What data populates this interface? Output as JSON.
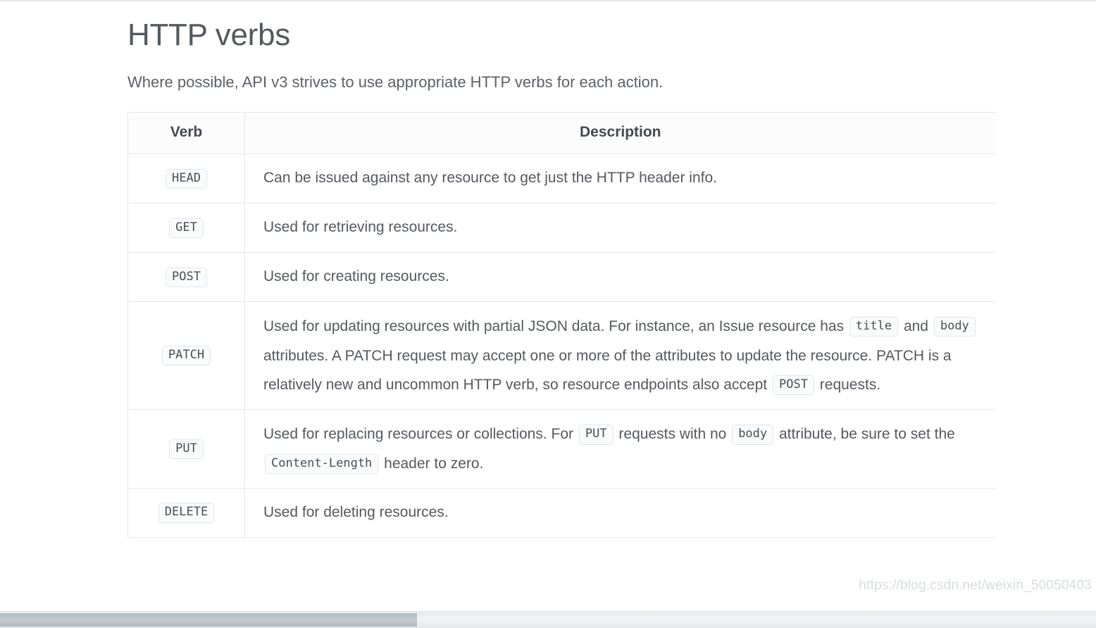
{
  "page": {
    "title": "HTTP verbs",
    "intro": "Where possible, API v3 strives to use appropriate HTTP verbs for each action."
  },
  "table": {
    "headers": {
      "verb": "Verb",
      "description": "Description"
    },
    "rows": [
      {
        "verb": "HEAD",
        "description": "Can be issued against any resource to get just the HTTP header info."
      },
      {
        "verb": "GET",
        "description": "Used for retrieving resources."
      },
      {
        "verb": "POST",
        "description": "Used for creating resources."
      },
      {
        "verb": "PATCH",
        "desc_part_1": "Used for updating resources with partial JSON data. For instance, an Issue resource has",
        "code_1": "title",
        "desc_part_2": "and",
        "code_2": "body",
        "desc_part_3": "attributes. A PATCH request may accept one or more of the attributes to update the resource. PATCH is a relatively new and uncommon HTTP verb, so resource endpoints also accept",
        "code_3": "POST",
        "desc_part_4": "requests."
      },
      {
        "verb": "PUT",
        "desc_part_1": "Used for replacing resources or collections. For",
        "code_1": "PUT",
        "desc_part_2": "requests with no",
        "code_2": "body",
        "desc_part_3": "attribute, be sure to set the",
        "code_3": "Content-Length",
        "desc_part_4": "header to zero."
      },
      {
        "verb": "DELETE",
        "description": "Used for deleting resources."
      }
    ]
  },
  "watermark": {
    "text": "https://blog.csdn.net/weixin_50050403"
  },
  "colors": {
    "text": "#55595e",
    "heading": "#45494e",
    "border": "#e6e8ea",
    "code_bg": "#fafbfc",
    "code_border": "#e2e5e8",
    "watermark": "#d7dbe0"
  }
}
